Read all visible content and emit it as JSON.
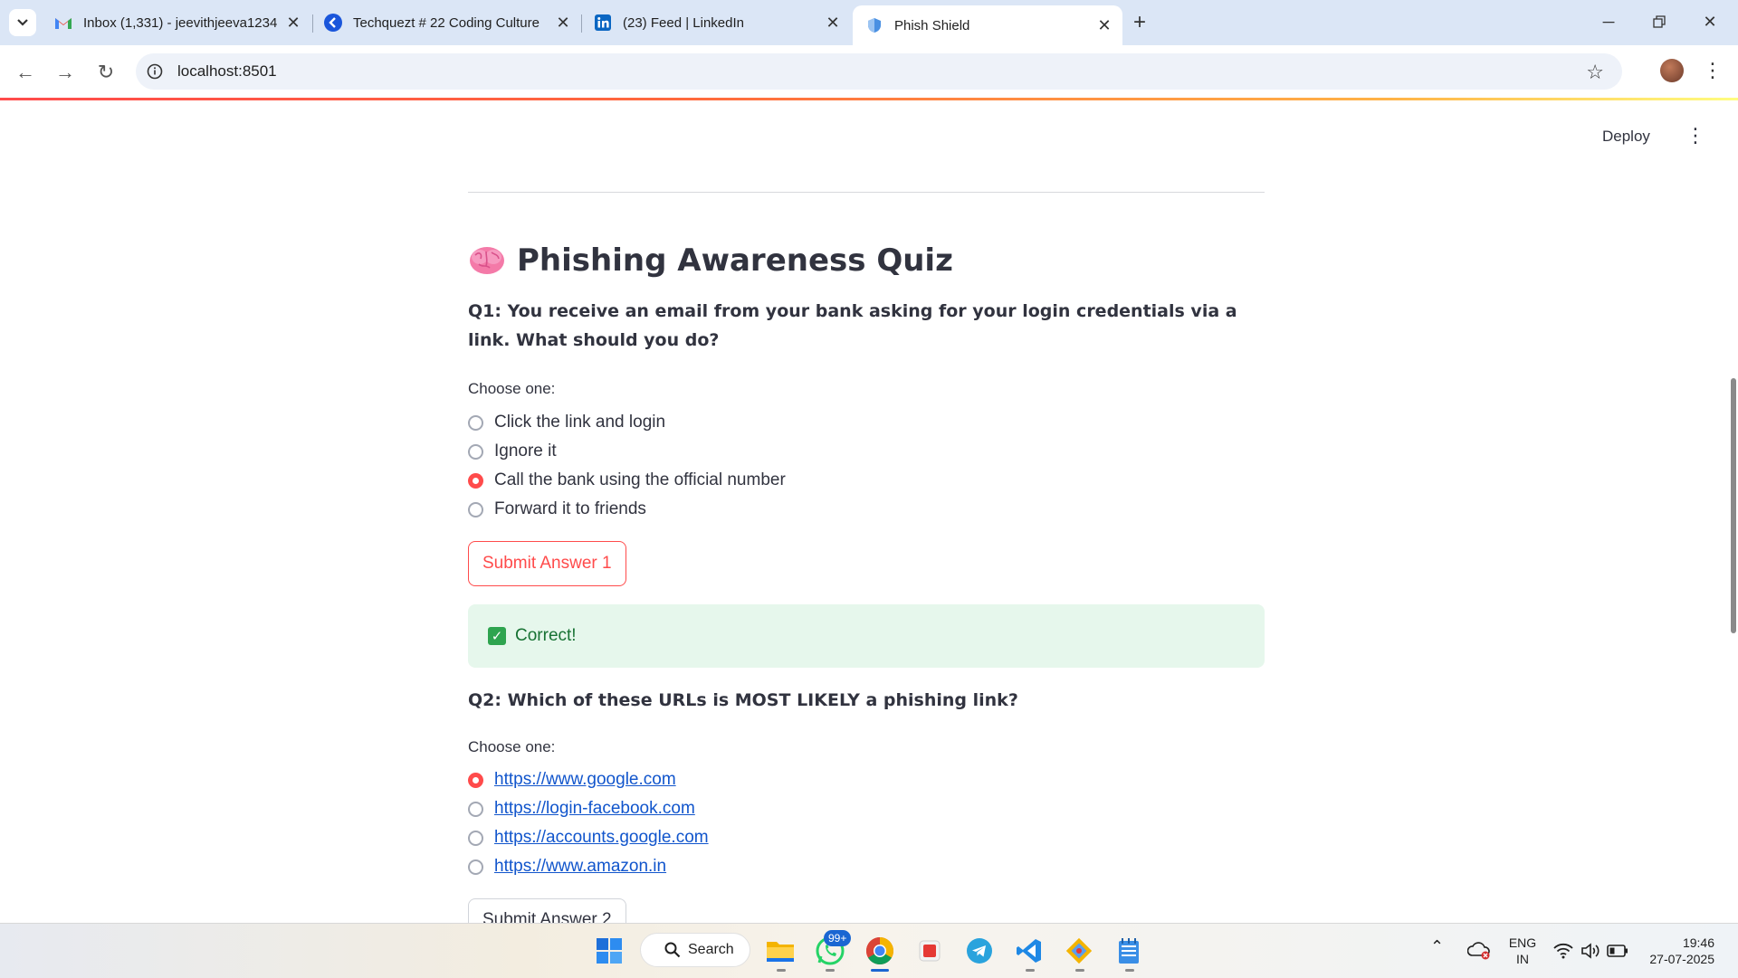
{
  "browser": {
    "tabs": [
      {
        "title": "Inbox (1,331) - jeevithjeeva1234",
        "icon": "gmail-icon",
        "active": false
      },
      {
        "title": "Techquezt # 22 Coding Culture",
        "icon": "k-logo-icon",
        "active": false
      },
      {
        "title": "(23) Feed | LinkedIn",
        "icon": "linkedin-icon",
        "active": false
      },
      {
        "title": "Phish Shield",
        "icon": "shield-icon",
        "active": true
      }
    ],
    "url": "localhost:8501"
  },
  "app": {
    "deploy_label": "Deploy",
    "title": "Phishing Awareness Quiz",
    "title_icon": "brain-emoji",
    "questions": [
      {
        "text": "Q1: You receive an email from your bank asking for your login credentials via a link. What should you do?",
        "choose_label": "Choose one:",
        "options": [
          "Click the link and login",
          "Ignore it",
          "Call the bank using the official number",
          "Forward it to friends"
        ],
        "selected_index": 2,
        "submit_label": "Submit Answer 1",
        "result": "Correct!"
      },
      {
        "text": "Q2: Which of these URLs is MOST LIKELY a phishing link?",
        "choose_label": "Choose one:",
        "options": [
          "https://www.google.com",
          "https://login-facebook.com",
          "https://accounts.google.com",
          "https://www.amazon.in"
        ],
        "selected_index": 0,
        "submit_label": "Submit Answer 2"
      }
    ]
  },
  "colors": {
    "accent": "#ff4b4b",
    "success_bg": "#e6f7ec",
    "success_text": "#177233",
    "link": "#1155cc"
  },
  "taskbar": {
    "search_label": "Search",
    "whatsapp_badge": "99+",
    "language": "ENG",
    "region": "IN",
    "time": "19:46",
    "date": "27-07-2025",
    "pinned": [
      "windows-start-icon",
      "file-explorer-icon",
      "whatsapp-icon",
      "chrome-icon",
      "red-app-icon",
      "telegram-icon",
      "vscode-icon",
      "git-icon",
      "notepad-icon"
    ]
  }
}
